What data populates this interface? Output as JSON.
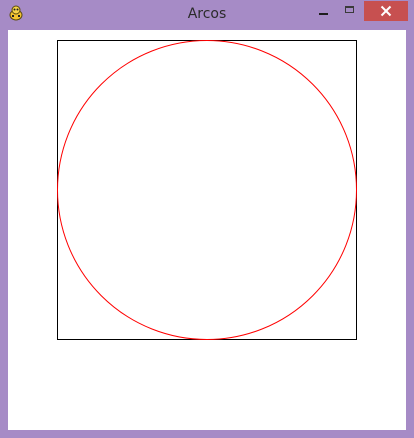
{
  "window": {
    "title": "Arcos",
    "icon": "pygame-snake-icon",
    "controls": {
      "minimize": "minimize-icon",
      "maximize": "maximize-icon",
      "close": "close-icon"
    },
    "colors": {
      "frame": "#a68bc6",
      "close_button": "#c75050",
      "client_background": "#ffffff"
    }
  },
  "drawing": {
    "shapes": [
      "rectangle",
      "circle"
    ],
    "colors": {
      "rectangle_stroke": "#000000",
      "circle_stroke": "#ff0000"
    }
  }
}
